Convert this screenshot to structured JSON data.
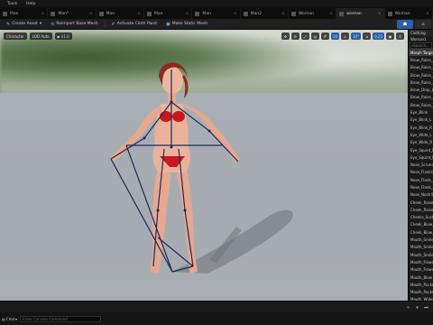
{
  "menu": [
    "Tools",
    "Help"
  ],
  "tabs": [
    {
      "label": "Man",
      "active": false
    },
    {
      "label": "Man*",
      "active": false
    },
    {
      "label": "Man",
      "active": false
    },
    {
      "label": "Man",
      "active": false
    },
    {
      "label": "Man",
      "active": false
    },
    {
      "label": "Man2",
      "active": false
    },
    {
      "label": "Woman",
      "active": false
    },
    {
      "label": "woman",
      "active": true
    },
    {
      "label": "Woman",
      "active": false
    }
  ],
  "toolbar": {
    "create_asset": "Create Asset",
    "reimport": "Reimport Base Mesh",
    "cloth": "Activate Cloth Paint",
    "static": "Make Static Mesh"
  },
  "viewport": {
    "character_btn": "Character",
    "lod_btn": "LOD Auto",
    "speed_btn": "x1.0",
    "right_values": [
      "10",
      "10°",
      "0.25",
      "4"
    ]
  },
  "panel": {
    "title": "Clothing",
    "asset_name": "Woman1",
    "search_placeholder": "Search...",
    "morphs": [
      {
        "name": "Morph Target",
        "selected": true
      },
      {
        "name": "Brow_Raise_Inner"
      },
      {
        "name": "Brow_Raise_Outer"
      },
      {
        "name": "Brow_Raise_Inner_L"
      },
      {
        "name": "Brow_Raise_Inner_R"
      },
      {
        "name": "Brow_Drop_L"
      },
      {
        "name": "Brow_Raise_L"
      },
      {
        "name": "Brow_Raise_R"
      },
      {
        "name": "Eye_Blink"
      },
      {
        "name": "Eye_Blink_L"
      },
      {
        "name": "Eye_Blink_R"
      },
      {
        "name": "Eye_Wide_L"
      },
      {
        "name": "Eye_Wide_R"
      },
      {
        "name": "Eye_Squint_L"
      },
      {
        "name": "Eye_Squint_R"
      },
      {
        "name": "Nose_Scrunch"
      },
      {
        "name": "Nose_Flanks_Raise"
      },
      {
        "name": "Nose_Flank_Raise_L"
      },
      {
        "name": "Nose_Flank_Raise_R"
      },
      {
        "name": "Nose_Nostrils_Flare"
      },
      {
        "name": "Cheek_Raise_L"
      },
      {
        "name": "Cheek_Raise_R"
      },
      {
        "name": "Cheeks_Suck"
      },
      {
        "name": "Cheek_Blow_L"
      },
      {
        "name": "Cheek_Blow_R"
      },
      {
        "name": "Mouth_Smile"
      },
      {
        "name": "Mouth_Smile_L"
      },
      {
        "name": "Mouth_Smile_R"
      },
      {
        "name": "Mouth_Frown"
      },
      {
        "name": "Mouth_Frown_L"
      },
      {
        "name": "Mouth_Blow"
      },
      {
        "name": "Mouth_Pucker"
      },
      {
        "name": "Mouth_Pucker_Open"
      },
      {
        "name": "Mouth_Widen"
      }
    ]
  },
  "status": {
    "cmd_label": "Cmd",
    "console_placeholder": "Enter Console Command"
  }
}
